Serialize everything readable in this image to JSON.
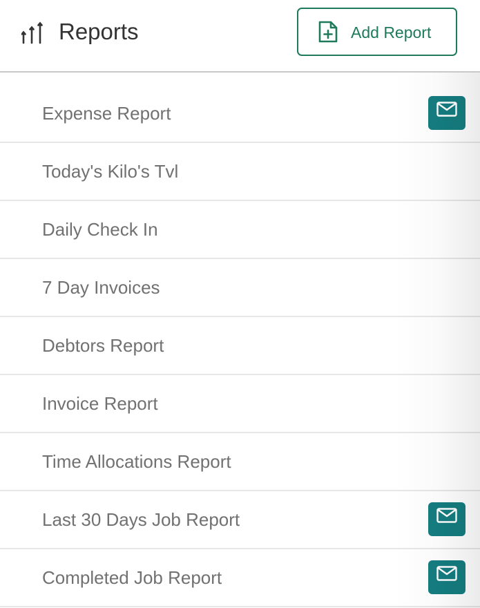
{
  "header": {
    "title": "Reports",
    "title_icon": "reports-bars-icon",
    "add_button": {
      "label": "Add Report",
      "icon": "file-plus-icon"
    }
  },
  "colors": {
    "accent": "#1f7a5c",
    "mail_button": "#157d80",
    "row_text": "#717171"
  },
  "reports": [
    {
      "label": "Expense Report",
      "has_email": true
    },
    {
      "label": "Today's Kilo's Tvl",
      "has_email": false
    },
    {
      "label": "Daily Check In",
      "has_email": false
    },
    {
      "label": "7 Day Invoices",
      "has_email": false
    },
    {
      "label": "Debtors Report",
      "has_email": false
    },
    {
      "label": "Invoice Report",
      "has_email": false
    },
    {
      "label": "Time Allocations Report",
      "has_email": false
    },
    {
      "label": "Last 30 Days Job Report",
      "has_email": true
    },
    {
      "label": "Completed Job Report",
      "has_email": true
    }
  ]
}
